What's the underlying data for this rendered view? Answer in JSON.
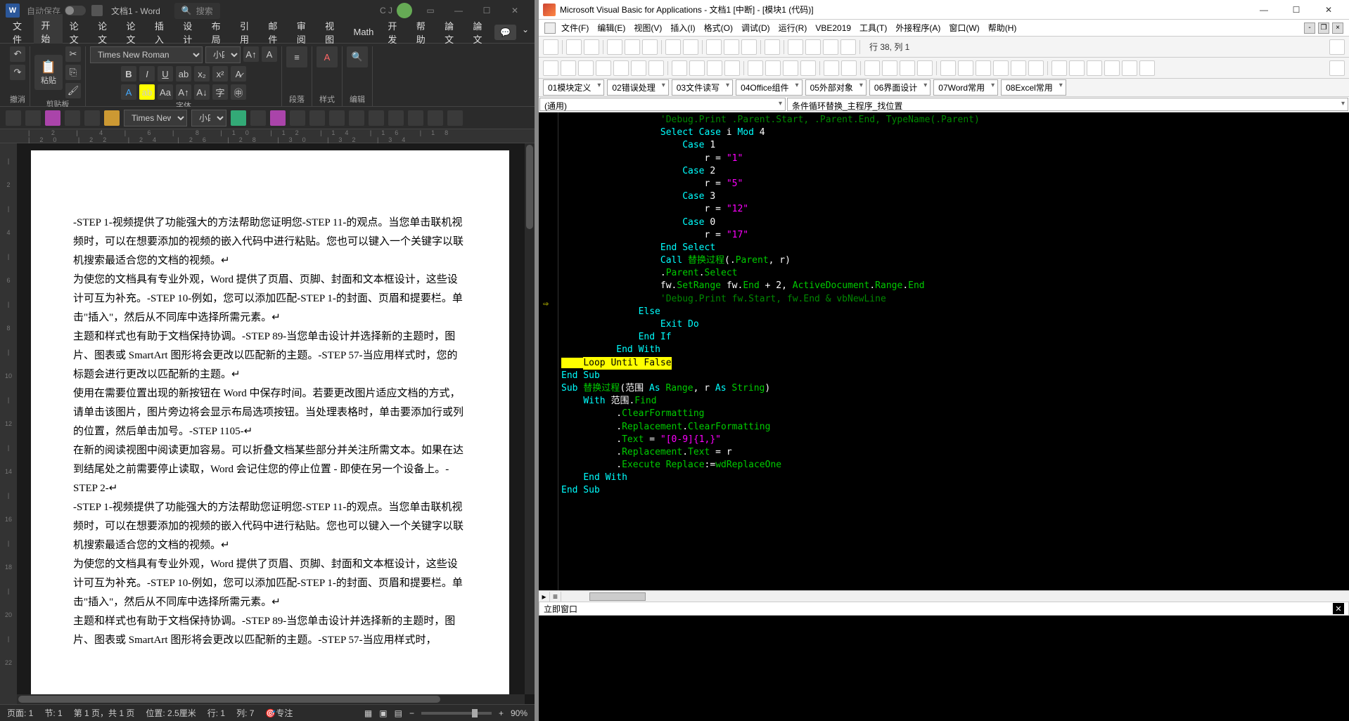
{
  "word": {
    "titlebar": {
      "autosave_label": "自动保存",
      "doc_title": "文档1 - Word",
      "search_placeholder": "搜索",
      "user": "C J"
    },
    "tabs": [
      "文件",
      "开始",
      "论文",
      "论文",
      "论文",
      "插入",
      "设计",
      "布局",
      "引用",
      "邮件",
      "审阅",
      "视图",
      "Math",
      "开发",
      "帮助",
      "論文",
      "論文"
    ],
    "active_tab": 1,
    "ribbon_groups": {
      "undo": "撤消",
      "clipboard": "剪贴板",
      "paste": "粘贴",
      "font": "字体",
      "paragraph": "段落",
      "styles": "样式",
      "editing": "编辑"
    },
    "font_name": "Times New Roman",
    "font_size": "小四",
    "sec_font_name": "Times New F",
    "sec_font_size": "小四",
    "document_paragraphs": [
      "-STEP 1-视频提供了功能强大的方法帮助您证明您-STEP 11-的观点。当您单击联机视频时，可以在想要添加的视频的嵌入代码中进行粘贴。您也可以键入一个关键字以联机搜索最适合您的文档的视频。↵",
      "为使您的文档具有专业外观，Word 提供了页眉、页脚、封面和文本框设计，这些设计可互为补充。-STEP 10-例如，您可以添加匹配-STEP 1-的封面、页眉和提要栏。单击\"插入\"，然后从不同库中选择所需元素。↵",
      "主题和样式也有助于文档保持协调。-STEP 89-当您单击设计并选择新的主题时，图片、图表或 SmartArt 图形将会更改以匹配新的主题。-STEP 57-当应用样式时，您的标题会进行更改以匹配新的主题。↵",
      "使用在需要位置出现的新按钮在 Word 中保存时间。若要更改图片适应文档的方式，请单击该图片，图片旁边将会显示布局选项按钮。当处理表格时，单击要添加行或列的位置，然后单击加号。-STEP 1105-↵",
      "在新的阅读视图中阅读更加容易。可以折叠文档某些部分并关注所需文本。如果在达到结尾处之前需要停止读取，Word 会记住您的停止位置 - 即使在另一个设备上。-STEP 2-↵",
      "-STEP 1-视频提供了功能强大的方法帮助您证明您-STEP 11-的观点。当您单击联机视频时，可以在想要添加的视频的嵌入代码中进行粘贴。您也可以键入一个关键字以联机搜索最适合您的文档的视频。↵",
      "为使您的文档具有专业外观，Word 提供了页眉、页脚、封面和文本框设计，这些设计可互为补充。-STEP 10-例如，您可以添加匹配-STEP 1-的封面、页眉和提要栏。单击\"插入\"，然后从不同库中选择所需元素。↵",
      "主题和样式也有助于文档保持协调。-STEP 89-当您单击设计并选择新的主题时，图片、图表或 SmartArt 图形将会更改以匹配新的主题。-STEP 57-当应用样式时，"
    ],
    "status": {
      "page": "页面: 1",
      "section": "节: 1",
      "pages": "第 1 页，共 1 页",
      "position": "位置: 2.5厘米",
      "line": "行: 1",
      "column": "列: 7",
      "focus": "专注",
      "zoom": "90%"
    }
  },
  "vba": {
    "title": "Microsoft Visual Basic for Applications - 文档1 [中断] - [模块1 (代码)]",
    "menus": [
      "文件(F)",
      "编辑(E)",
      "视图(V)",
      "插入(I)",
      "格式(O)",
      "调试(D)",
      "运行(R)",
      "VBE2019",
      "工具(T)",
      "外接程序(A)",
      "窗口(W)",
      "帮助(H)"
    ],
    "position": "行 38, 列 1",
    "category_dropdowns": [
      "01模块定义",
      "02错误处理",
      "03文件读写",
      "04Office组件",
      "05外部对象",
      "06界面设计",
      "07Word常用",
      "08Excel常用"
    ],
    "proc_left": "(通用)",
    "proc_right": "条件循环替换_主程序_找位置",
    "immediate_title": "立即窗口",
    "code_lines": [
      {
        "indent": 18,
        "parts": [
          {
            "c": "dgreen",
            "t": "'Debug.Print .Parent.Start, .Parent.End, TypeName(.Parent)"
          }
        ]
      },
      {
        "indent": 18,
        "parts": [
          {
            "c": "blue",
            "t": "Select Case"
          },
          {
            "c": "white",
            "t": " i "
          },
          {
            "c": "blue",
            "t": "Mod"
          },
          {
            "c": "white",
            "t": " 4"
          }
        ]
      },
      {
        "indent": 22,
        "parts": [
          {
            "c": "blue",
            "t": "Case"
          },
          {
            "c": "white",
            "t": " 1"
          }
        ]
      },
      {
        "indent": 26,
        "parts": [
          {
            "c": "white",
            "t": "r = "
          },
          {
            "c": "mag",
            "t": "\"1\""
          }
        ]
      },
      {
        "indent": 22,
        "parts": [
          {
            "c": "blue",
            "t": "Case"
          },
          {
            "c": "white",
            "t": " 2"
          }
        ]
      },
      {
        "indent": 26,
        "parts": [
          {
            "c": "white",
            "t": "r = "
          },
          {
            "c": "mag",
            "t": "\"5\""
          }
        ]
      },
      {
        "indent": 22,
        "parts": [
          {
            "c": "blue",
            "t": "Case"
          },
          {
            "c": "white",
            "t": " 3"
          }
        ]
      },
      {
        "indent": 26,
        "parts": [
          {
            "c": "white",
            "t": "r = "
          },
          {
            "c": "mag",
            "t": "\"12\""
          }
        ]
      },
      {
        "indent": 22,
        "parts": [
          {
            "c": "blue",
            "t": "Case"
          },
          {
            "c": "white",
            "t": " 0"
          }
        ]
      },
      {
        "indent": 26,
        "parts": [
          {
            "c": "white",
            "t": "r = "
          },
          {
            "c": "mag",
            "t": "\"17\""
          }
        ]
      },
      {
        "indent": 18,
        "parts": [
          {
            "c": "blue",
            "t": "End Select"
          }
        ]
      },
      {
        "indent": 18,
        "parts": [
          {
            "c": "blue",
            "t": "Call"
          },
          {
            "c": "green",
            "t": " 替换过程"
          },
          {
            "c": "white",
            "t": "(."
          },
          {
            "c": "green",
            "t": "Parent"
          },
          {
            "c": "white",
            "t": ", r)"
          }
        ]
      },
      {
        "indent": 18,
        "parts": [
          {
            "c": "white",
            "t": "."
          },
          {
            "c": "green",
            "t": "Parent"
          },
          {
            "c": "white",
            "t": "."
          },
          {
            "c": "green",
            "t": "Select"
          }
        ]
      },
      {
        "indent": 18,
        "parts": [
          {
            "c": "white",
            "t": "fw."
          },
          {
            "c": "green",
            "t": "SetRange"
          },
          {
            "c": "white",
            "t": " fw."
          },
          {
            "c": "green",
            "t": "End"
          },
          {
            "c": "white",
            "t": " + 2, "
          },
          {
            "c": "green",
            "t": "ActiveDocument"
          },
          {
            "c": "white",
            "t": "."
          },
          {
            "c": "green",
            "t": "Range"
          },
          {
            "c": "white",
            "t": "."
          },
          {
            "c": "green",
            "t": "End"
          }
        ]
      },
      {
        "indent": 18,
        "parts": [
          {
            "c": "dgreen",
            "t": "'Debug.Print fw.Start, fw.End & vbNewLine"
          }
        ]
      },
      {
        "indent": 14,
        "parts": [
          {
            "c": "blue",
            "t": "Else"
          }
        ]
      },
      {
        "indent": 18,
        "parts": [
          {
            "c": "blue",
            "t": "Exit Do"
          }
        ]
      },
      {
        "indent": 14,
        "parts": [
          {
            "c": "blue",
            "t": "End If"
          }
        ]
      },
      {
        "indent": 10,
        "parts": [
          {
            "c": "blue",
            "t": "End With"
          }
        ]
      },
      {
        "indent": 6,
        "bp": true,
        "parts": [
          {
            "c": "black",
            "t": "Loop Until False"
          }
        ]
      },
      {
        "indent": 0,
        "parts": [
          {
            "c": "blue",
            "t": "End Sub"
          }
        ]
      },
      {
        "indent": 0,
        "parts": [
          {
            "c": "white",
            "t": ""
          }
        ]
      },
      {
        "indent": 0,
        "parts": [
          {
            "c": "blue",
            "t": "Sub"
          },
          {
            "c": "green",
            "t": " 替换过程"
          },
          {
            "c": "white",
            "t": "(范围 "
          },
          {
            "c": "blue",
            "t": "As"
          },
          {
            "c": "green",
            "t": " Range"
          },
          {
            "c": "white",
            "t": ", r "
          },
          {
            "c": "blue",
            "t": "As"
          },
          {
            "c": "green",
            "t": " String"
          },
          {
            "c": "white",
            "t": ")"
          }
        ]
      },
      {
        "indent": 4,
        "parts": [
          {
            "c": "blue",
            "t": "With"
          },
          {
            "c": "white",
            "t": " 范围."
          },
          {
            "c": "green",
            "t": "Find"
          }
        ]
      },
      {
        "indent": 10,
        "parts": [
          {
            "c": "white",
            "t": "."
          },
          {
            "c": "green",
            "t": "ClearFormatting"
          }
        ]
      },
      {
        "indent": 10,
        "parts": [
          {
            "c": "white",
            "t": "."
          },
          {
            "c": "green",
            "t": "Replacement"
          },
          {
            "c": "white",
            "t": "."
          },
          {
            "c": "green",
            "t": "ClearFormatting"
          }
        ]
      },
      {
        "indent": 10,
        "parts": [
          {
            "c": "white",
            "t": "."
          },
          {
            "c": "green",
            "t": "Text"
          },
          {
            "c": "white",
            "t": " = "
          },
          {
            "c": "mag",
            "t": "\"[0-9]{1,}\""
          }
        ]
      },
      {
        "indent": 10,
        "parts": [
          {
            "c": "white",
            "t": "."
          },
          {
            "c": "green",
            "t": "Replacement"
          },
          {
            "c": "white",
            "t": "."
          },
          {
            "c": "green",
            "t": "Text"
          },
          {
            "c": "white",
            "t": " = r"
          }
        ]
      },
      {
        "indent": 10,
        "parts": [
          {
            "c": "white",
            "t": "."
          },
          {
            "c": "green",
            "t": "Execute"
          },
          {
            "c": "green",
            "t": " Replace"
          },
          {
            "c": "white",
            "t": ":="
          },
          {
            "c": "green",
            "t": "wdReplaceOne"
          }
        ]
      },
      {
        "indent": 4,
        "parts": [
          {
            "c": "blue",
            "t": "End With"
          }
        ]
      },
      {
        "indent": 0,
        "parts": [
          {
            "c": "blue",
            "t": "End Sub"
          }
        ]
      }
    ]
  }
}
